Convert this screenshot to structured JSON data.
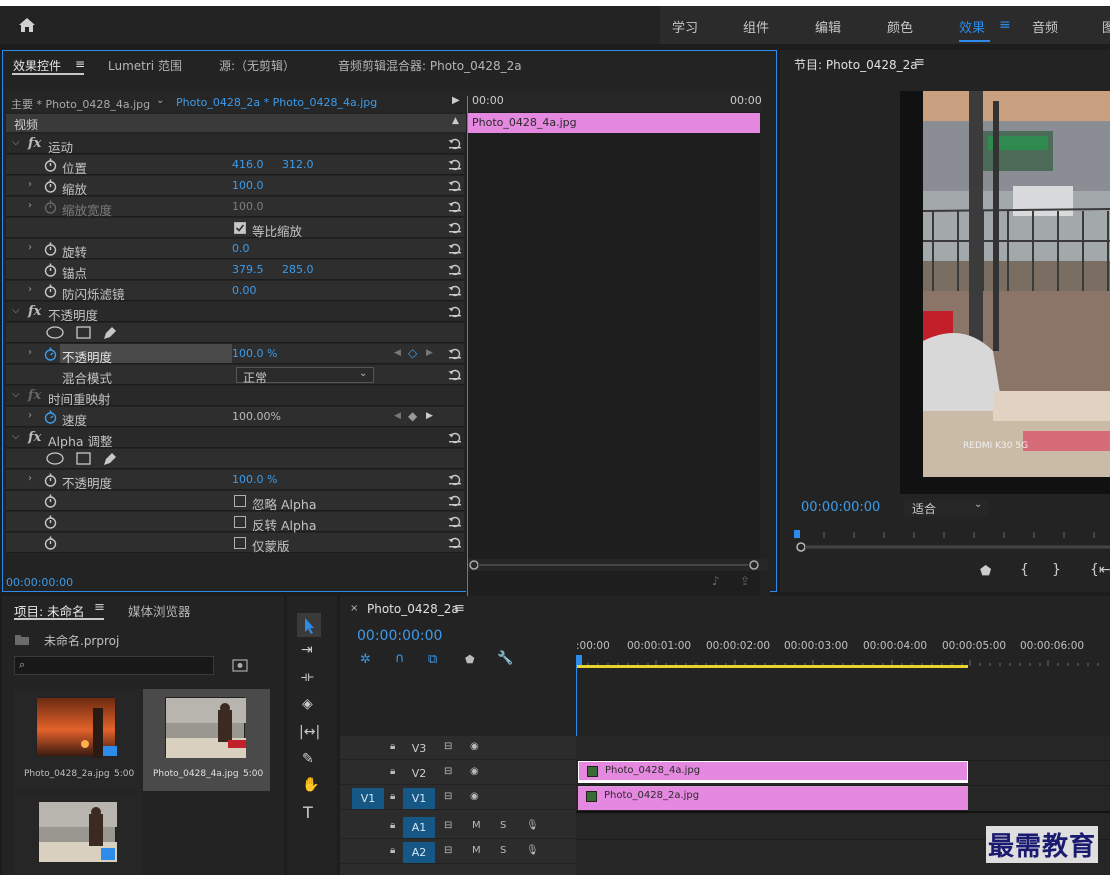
{
  "workspaces": {
    "items": [
      "学习",
      "组件",
      "编辑",
      "颜色",
      "效果",
      "音频",
      "图"
    ],
    "active": "效果",
    "menu_icon": "hamburger-icon"
  },
  "effect_controls": {
    "tabs": [
      "效果控件",
      "Lumetri 范围",
      "源:（无剪辑）",
      "音频剪辑混合器: Photo_0428_2a"
    ],
    "master_clip": "主要 * Photo_0428_4a.jpg",
    "sequence_clip": "Photo_0428_2a * Photo_0428_4a.jpg",
    "time_start": "00:00",
    "time_end": "00:00",
    "clip_name": "Photo_0428_4a.jpg",
    "section_video": "视频",
    "motion": {
      "label": "运动",
      "position_label": "位置",
      "position_x": "416.0",
      "position_y": "312.0",
      "scale_label": "缩放",
      "scale": "100.0",
      "scale_width_label": "缩放宽度",
      "scale_width": "100.0",
      "uniform_label": "等比缩放",
      "rotation_label": "旋转",
      "rotation": "0.0",
      "anchor_label": "锚点",
      "anchor_x": "379.5",
      "anchor_y": "285.0",
      "flicker_label": "防闪烁滤镜",
      "flicker": "0.00"
    },
    "opacity": {
      "label": "不透明度",
      "opacity_label": "不透明度",
      "opacity": "100.0 %",
      "blend_label": "混合模式",
      "blend": "正常"
    },
    "time_remap": {
      "label": "时间重映射",
      "speed_label": "速度",
      "speed": "100.00%"
    },
    "alpha": {
      "label": "Alpha 调整",
      "opacity_label": "不透明度",
      "opacity": "100.0 %",
      "ignore": "忽略 Alpha",
      "invert": "反转 Alpha",
      "mask_only": "仅蒙版"
    },
    "timecode": "00:00:00:00"
  },
  "program": {
    "title": "节目: Photo_0428_2a",
    "timecode": "00:00:00:00",
    "fit": "适合",
    "watermark_text": "REDMI K30 5G"
  },
  "project": {
    "tab_project": "项目: 未命名",
    "tab_media": "媒体浏览器",
    "file": "未命名.prproj",
    "items": [
      {
        "name": "Photo_0428_2a.jpg",
        "duration": "5:00"
      },
      {
        "name": "Photo_0428_4a.jpg",
        "duration": "5:00"
      }
    ]
  },
  "timeline": {
    "seq_name": "Photo_0428_2a",
    "timecode": "00:00:00:00",
    "ruler": [
      ":00:00",
      "00:00:01:00",
      "00:00:02:00",
      "00:00:03:00",
      "00:00:04:00",
      "00:00:05:00",
      "00:00:06:00"
    ],
    "tracks": {
      "v3": "V3",
      "v2": "V2",
      "v1": "V1",
      "src_v1": "V1",
      "a1": "A1",
      "a2": "A2",
      "m": "M",
      "s": "S"
    },
    "clip_v2": "Photo_0428_4a.jpg",
    "clip_v1": "Photo_0428_2a.jpg"
  },
  "brand_watermark": "最需教育",
  "colors": {
    "accent": "#2d8ceb",
    "clip": "#e589e0"
  }
}
